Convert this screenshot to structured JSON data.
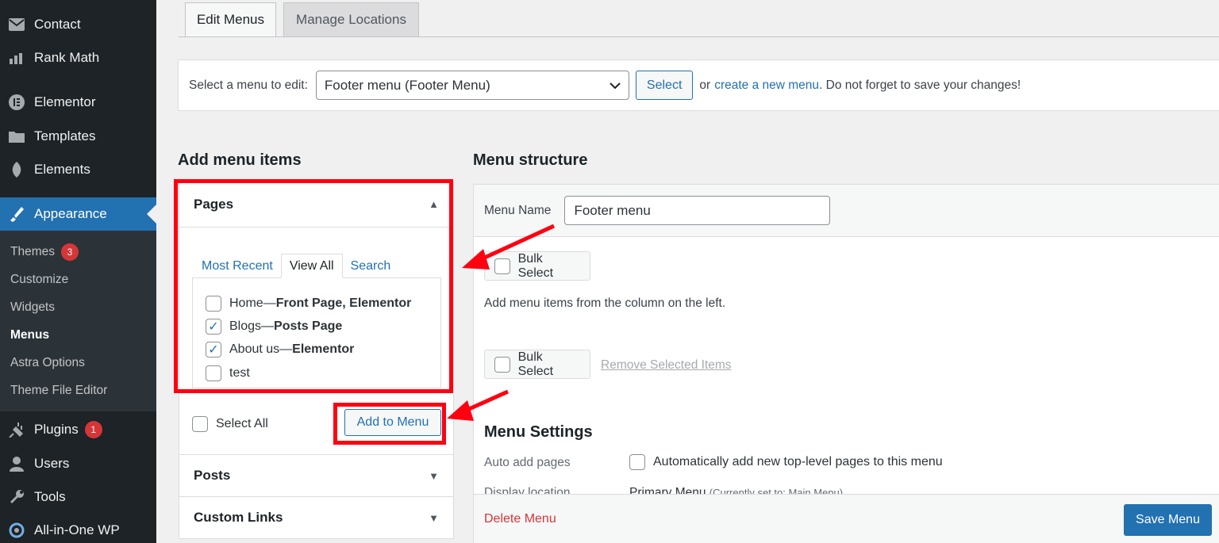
{
  "sidebar": {
    "items": [
      {
        "label": "Contact",
        "icon": "mail-icon"
      },
      {
        "label": "Rank Math",
        "icon": "chart-icon"
      },
      {
        "label": "Elementor",
        "icon": "elementor-icon"
      },
      {
        "label": "Templates",
        "icon": "folder-icon"
      },
      {
        "label": "Elements",
        "icon": "leaf-icon"
      },
      {
        "label": "Appearance",
        "icon": "brush-icon"
      },
      {
        "label": "Plugins",
        "icon": "plug-icon",
        "badge": "1"
      },
      {
        "label": "Users",
        "icon": "user-icon"
      },
      {
        "label": "Tools",
        "icon": "wrench-icon"
      },
      {
        "label": "All-in-One WP",
        "icon": "circle-icon"
      }
    ],
    "submenu": [
      {
        "label": "Themes",
        "badge": "3"
      },
      {
        "label": "Customize"
      },
      {
        "label": "Widgets"
      },
      {
        "label": "Menus"
      },
      {
        "label": "Astra Options"
      },
      {
        "label": "Theme File Editor"
      }
    ]
  },
  "tabs": {
    "edit": "Edit Menus",
    "manage": "Manage Locations"
  },
  "select_bar": {
    "label": "Select a menu to edit:",
    "value": "Footer menu (Footer Menu)",
    "button": "Select",
    "or": "or",
    "create_link": "create a new menu",
    "suffix": ". Do not forget to save your changes!"
  },
  "add_items": {
    "heading": "Add menu items",
    "pages": {
      "title": "Pages",
      "tabs": [
        "Most Recent",
        "View All",
        "Search"
      ],
      "rows": [
        {
          "name": "Home",
          "sep": " — ",
          "meta": "Front Page, Elementor",
          "checked": false
        },
        {
          "name": "Blogs",
          "sep": " — ",
          "meta": "Posts Page",
          "checked": true
        },
        {
          "name": "About us",
          "sep": " — ",
          "meta": "Elementor",
          "checked": true
        },
        {
          "name": "test",
          "sep": "",
          "meta": "",
          "checked": false
        }
      ],
      "select_all": "Select All",
      "add_button": "Add to Menu"
    },
    "posts": "Posts",
    "custom_links": "Custom Links"
  },
  "structure": {
    "heading": "Menu structure",
    "menu_name_label": "Menu Name",
    "menu_name_value": "Footer menu",
    "bulk_select": "Bulk Select",
    "hint": "Add menu items from the column on the left.",
    "remove_selected": "Remove Selected Items",
    "settings_title": "Menu Settings",
    "auto_add_label": "Auto add pages",
    "auto_add_option": "Automatically add new top-level pages to this menu",
    "display_location_label": "Display location",
    "primary_menu": "Primary Menu",
    "primary_menu_note": "(Currently set to: Main Menu)",
    "delete": "Delete Menu",
    "save": "Save Menu"
  },
  "colors": {
    "sidebar_bg": "#1d2327",
    "accent": "#2271b1",
    "highlight": "#ff0010",
    "danger": "#d63638"
  }
}
